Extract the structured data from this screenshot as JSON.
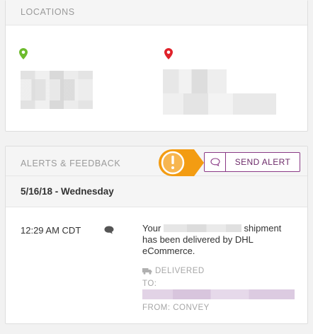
{
  "locations": {
    "title": "LOCATIONS",
    "origin_pin_color": "#6dbb2d",
    "destination_pin_color": "#e0222a"
  },
  "alerts": {
    "title": "ALERTS & FEEDBACK",
    "send_alert_label": "SEND ALERT",
    "accent_color": "#8a3a86",
    "warning_badge_color": "#f39c12",
    "date_header": "5/16/18 - Wednesday",
    "event": {
      "time": "12:29 AM CDT",
      "message_prefix": "Your",
      "message_suffix": "shipment has been delivered by DHL eCommerce.",
      "status": "DELIVERED",
      "to_label": "TO:",
      "from_label": "FROM: CONVEY"
    }
  }
}
